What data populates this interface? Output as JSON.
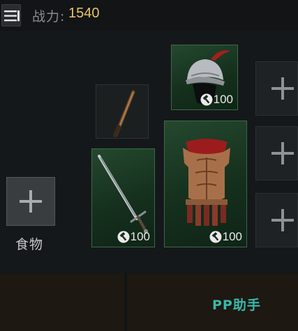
{
  "header": {
    "power_label": "战力:",
    "power_value": "1540"
  },
  "slots": {
    "food_label": "食物",
    "helmet_durability": "100",
    "sword_durability": "100",
    "armor_durability": "100"
  },
  "watermark": "PP助手",
  "colors": {
    "power_value": "#e6c56a",
    "equipped_slot": "#24482e",
    "watermark": "#3ab8a8"
  },
  "icons": [
    "menu-icon",
    "plus-icon",
    "hammer-icon",
    "dagger-icon",
    "sword-icon",
    "helmet-icon",
    "armor-icon"
  ]
}
